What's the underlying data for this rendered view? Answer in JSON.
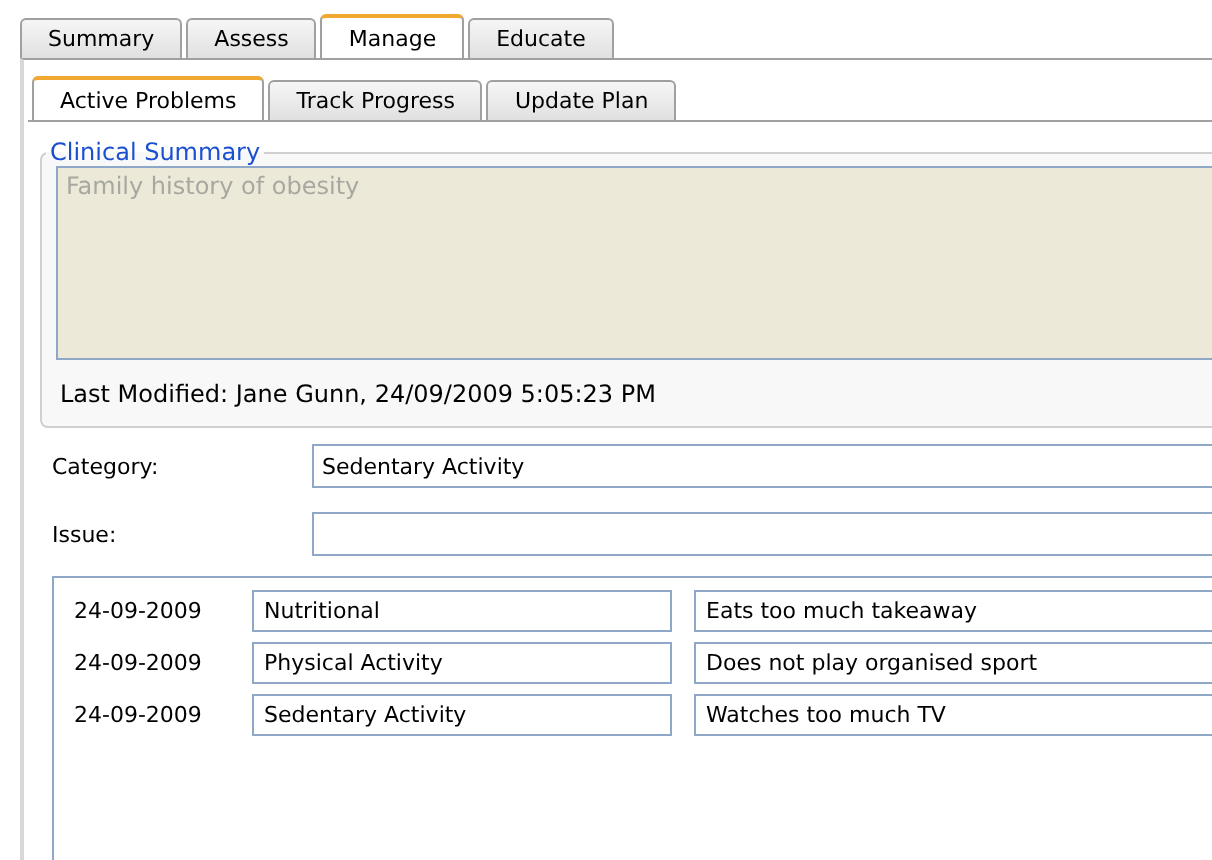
{
  "outer_tabs": [
    {
      "label": "Summary",
      "selected": false
    },
    {
      "label": "Assess",
      "selected": false
    },
    {
      "label": "Manage",
      "selected": true
    },
    {
      "label": "Educate",
      "selected": false
    }
  ],
  "inner_tabs": [
    {
      "label": "Active Problems",
      "selected": true
    },
    {
      "label": "Track Progress",
      "selected": false
    },
    {
      "label": "Update Plan",
      "selected": false
    }
  ],
  "clinical_summary": {
    "legend": "Clinical Summary",
    "text": "Family history of obesity",
    "last_modified": "Last Modified: Jane Gunn, 24/09/2009 5:05:23 PM"
  },
  "category": {
    "label": "Category:",
    "value": "Sedentary Activity"
  },
  "issue": {
    "label": "Issue:"
  },
  "problems": [
    {
      "date": "24-09-2009",
      "category": "Nutritional",
      "description": "Eats too much takeaway"
    },
    {
      "date": "24-09-2009",
      "category": "Physical Activity",
      "description": "Does not play organised sport"
    },
    {
      "date": "24-09-2009",
      "category": "Sedentary Activity",
      "description": "Watches too much TV"
    }
  ]
}
